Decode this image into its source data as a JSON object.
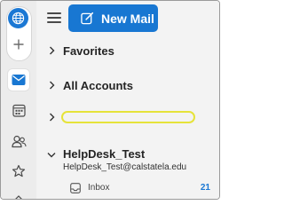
{
  "app": {
    "accent_color": "#1877d2",
    "rail_background": "#ececec",
    "pane_background": "#f3f3f3"
  },
  "rail": {
    "items": [
      {
        "icon": "globe-icon",
        "active": false
      },
      {
        "icon": "plus-icon",
        "active": false
      },
      {
        "icon": "mail-icon",
        "active": true
      },
      {
        "icon": "calendar-icon",
        "active": false
      },
      {
        "icon": "people-icon",
        "active": false
      },
      {
        "icon": "star-icon",
        "active": false
      },
      {
        "icon": "more-icon",
        "active": false
      }
    ]
  },
  "toolbar": {
    "menu_icon": "hamburger-icon",
    "new_mail_label": "New Mail",
    "new_mail_icon": "compose-icon"
  },
  "folders": {
    "favorites_label": "Favorites",
    "all_accounts_label": "All Accounts",
    "redacted_account_label": ""
  },
  "account": {
    "name": "HelpDesk_Test",
    "email": "HelpDesk_Test@calstatela.edu",
    "inbox": {
      "label": "Inbox",
      "count": "21",
      "icon": "inbox-icon"
    }
  }
}
